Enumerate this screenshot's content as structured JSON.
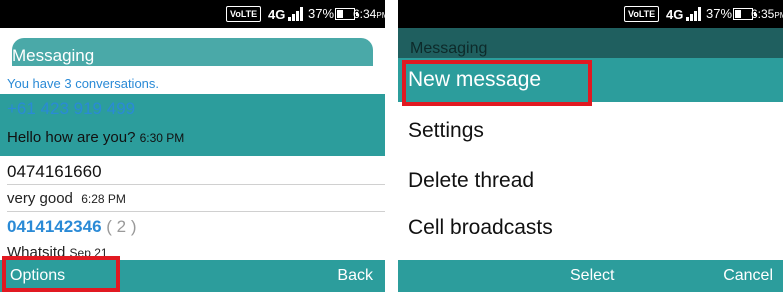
{
  "left": {
    "status": {
      "volte": "VoLTE",
      "network": "4G",
      "battery": "37%",
      "time": "6:34",
      "time_suffix": "PM"
    },
    "title": "Messaging",
    "subtitle": "You have 3 conversations.",
    "conversations": [
      {
        "name": "+61 423 919 499",
        "snippet": "Hello how are you?",
        "time": "6:30 PM"
      },
      {
        "name": "0474161660",
        "snippet": "very good",
        "time": "6:28 PM"
      },
      {
        "name": "0414142346",
        "count": "( 2 )",
        "snippet": "Whatsitd",
        "time": "Sep 21"
      }
    ],
    "softkeys": {
      "left": "Options",
      "right": "Back"
    }
  },
  "right": {
    "status": {
      "volte": "VoLTE",
      "network": "4G",
      "battery": "37%",
      "time": "6:35",
      "time_suffix": "PM"
    },
    "behind_title": "Messaging",
    "menu": [
      "New message",
      "Settings",
      "Delete thread",
      "Cell broadcasts"
    ],
    "softkeys": {
      "center": "Select",
      "right": "Cancel"
    }
  },
  "colors": {
    "teal": "#2c9d9c",
    "title_teal": "#4aa9a8",
    "highlight_red": "#e11921",
    "link_blue": "#2a8ad6"
  }
}
